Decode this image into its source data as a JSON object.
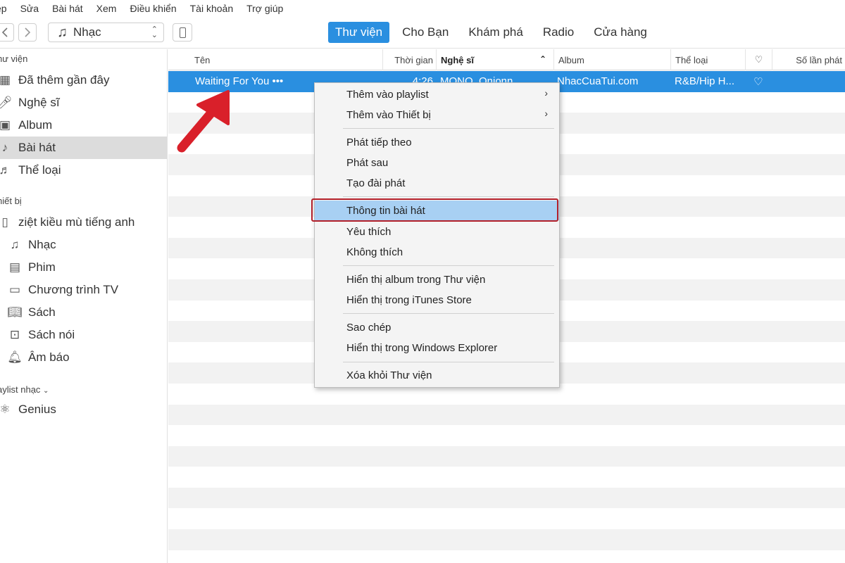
{
  "menubar": [
    "ệp",
    "Sửa",
    "Bài hát",
    "Xem",
    "Điều khiển",
    "Tài khoản",
    "Trợ giúp"
  ],
  "toolbar": {
    "back_icon": "chevron-left-icon",
    "forward_icon": "chevron-right-icon",
    "source": "Nhạc",
    "tabs": [
      "Thư viện",
      "Cho Bạn",
      "Khám phá",
      "Radio",
      "Cửa hàng"
    ],
    "active_tab": "Thư viện"
  },
  "sidebar": {
    "library_header": "hư viện",
    "library_items": [
      "Đã thêm gần đây",
      "Nghệ sĩ",
      "Album",
      "Bài hát",
      "Thể loại"
    ],
    "selected_item": "Bài hát",
    "devices_header": "hiết bị",
    "device_name": "ziệt kiều mù tiếng anh",
    "device_items": [
      "Nhạc",
      "Phim",
      "Chương trình TV",
      "Sách",
      "Sách nói",
      "Âm báo"
    ],
    "playlists_header": "aylist nhạc",
    "playlist_items": [
      "Genius"
    ]
  },
  "table": {
    "columns": [
      "Tên",
      "Thời gian",
      "Nghệ sĩ",
      "Album",
      "Thể loại",
      "♡",
      "Số lần phát"
    ],
    "sort_column": "Nghệ sĩ",
    "selected_row": {
      "name": "Waiting For You",
      "more": "•••",
      "time": "4:26",
      "artist": "MONO, Onionn",
      "album": "NhacCuaTui.com",
      "genre": "R&B/Hip H...",
      "love": "♡"
    }
  },
  "context_menu": {
    "items": [
      "Thêm vào playlist",
      "Thêm vào Thiết bị",
      "Phát tiếp theo",
      "Phát sau",
      "Tạo đài phát",
      "Thông tin bài hát",
      "Yêu thích",
      "Không thích",
      "Hiển thị album trong Thư viện",
      "Hiển thị trong iTunes Store",
      "Sao chép",
      "Hiển thị trong Windows Explorer",
      "Xóa khỏi Thư viện"
    ],
    "submenu_arrow": "›",
    "highlighted": "Thông tin bài hát"
  },
  "colors": {
    "accent": "#2a8fe0",
    "highlight": "#a8d0f3",
    "annotation": "#d9202a",
    "annotation_box": "#b3202a"
  }
}
